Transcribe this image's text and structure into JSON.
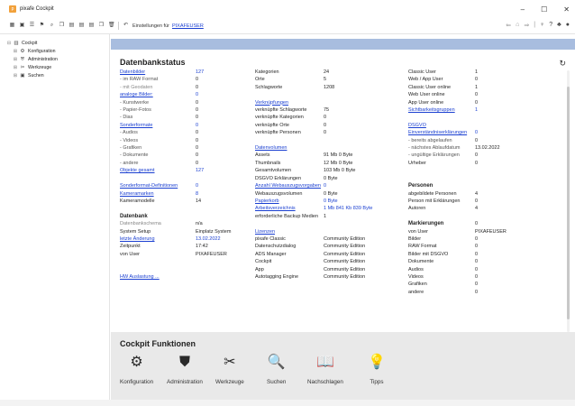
{
  "window": {
    "title": "pixafe Cockpit",
    "minimize": "–",
    "maximize": "☐",
    "close": "✕"
  },
  "toolbar": {
    "settings_label": "Einstellungen für",
    "settings_link": "PIXAFEUSER"
  },
  "tree": [
    {
      "label": "Cockpit",
      "icon": "cockpit-icon",
      "level": 0
    },
    {
      "label": "Konfiguration",
      "icon": "gear-icon",
      "level": 1
    },
    {
      "label": "Administration",
      "icon": "shield-icon",
      "level": 1
    },
    {
      "label": "Werkzeuge",
      "icon": "tools-icon",
      "level": 1
    },
    {
      "label": "Suchen",
      "icon": "search-icon",
      "level": 1
    }
  ],
  "main": {
    "title": "Datenbankstatus"
  },
  "stats": {
    "col1": [
      {
        "label": "Datenbilder",
        "value": "127",
        "style": "link"
      },
      {
        "label": "- im RAW Format",
        "value": "0",
        "style": "sub"
      },
      {
        "label": "- mit Geodaten",
        "value": "0",
        "style": "dim"
      },
      {
        "label": "analoge Bilder:",
        "value": "0",
        "style": "link"
      },
      {
        "label": "- Kunstwerke",
        "value": "0",
        "style": "sub"
      },
      {
        "label": "- Papier-Fotos",
        "value": "0",
        "style": "sub"
      },
      {
        "label": "- Dias",
        "value": "0",
        "style": "sub"
      },
      {
        "label": "Sonderformate",
        "value": "0",
        "style": "link"
      },
      {
        "label": "- Audios",
        "value": "0",
        "style": "sub"
      },
      {
        "label": "- Videos",
        "value": "0",
        "style": "sub"
      },
      {
        "label": "- Grafiken",
        "value": "0",
        "style": "sub"
      },
      {
        "label": "- Dokumente",
        "value": "0",
        "style": "sub"
      },
      {
        "label": "- andere",
        "value": "0",
        "style": "sub"
      },
      {
        "label": "Objekte gesamt",
        "value": "127",
        "style": "link"
      },
      {
        "label": "",
        "value": "",
        "style": ""
      },
      {
        "label": "Sonderformat-Definitionen",
        "value": "0",
        "style": "link"
      },
      {
        "label": "Kameramarken",
        "value": "8",
        "style": "link"
      },
      {
        "label": "Kameramodelle",
        "value": "14",
        "style": ""
      },
      {
        "label": "",
        "value": "",
        "style": ""
      },
      {
        "label": "Datenbank",
        "value": "",
        "style": "header"
      },
      {
        "label": "Datenbankschema",
        "value": "n/a",
        "style": "dim"
      },
      {
        "label": "System Setup",
        "value": "Einplatz System",
        "style": ""
      },
      {
        "label": "letzte Änderung",
        "value": "13.02.2022",
        "style": "link"
      },
      {
        "label": "Zeitpunkt",
        "value": "17:42",
        "style": ""
      },
      {
        "label": "von User",
        "value": "PIXAFEUSER",
        "style": ""
      },
      {
        "label": "",
        "value": "",
        "style": ""
      },
      {
        "label": "",
        "value": "",
        "style": ""
      },
      {
        "label": "HW Auslastung ...",
        "value": "",
        "style": "link"
      }
    ],
    "col2": [
      {
        "label": "Kategorien",
        "value": "24",
        "style": ""
      },
      {
        "label": "Orte",
        "value": "5",
        "style": ""
      },
      {
        "label": "Schlagworte",
        "value": "1208",
        "style": ""
      },
      {
        "label": "",
        "value": "",
        "style": ""
      },
      {
        "label": "Verknüpfungen",
        "value": "",
        "style": "link"
      },
      {
        "label": "verknüpfte Schlagworte",
        "value": "75",
        "style": ""
      },
      {
        "label": "verknüpfte Kategorien",
        "value": "0",
        "style": ""
      },
      {
        "label": "verknüpfte Orte",
        "value": "0",
        "style": ""
      },
      {
        "label": "verknüpfte Personen",
        "value": "0",
        "style": ""
      },
      {
        "label": "",
        "value": "",
        "style": ""
      },
      {
        "label": "Datenvolumen",
        "value": "",
        "style": "link"
      },
      {
        "label": "Assets",
        "value": "91 Mb 0 Byte",
        "style": ""
      },
      {
        "label": "Thumbnails",
        "value": "12 Mb 0 Byte",
        "style": ""
      },
      {
        "label": "Gesamtvolumen",
        "value": "103 Mb 0 Byte",
        "style": ""
      },
      {
        "label": "DSGVO Erklärungen",
        "value": "0 Byte",
        "style": ""
      },
      {
        "label": "Anzahl Webauszugsvorgaben",
        "value": "0",
        "style": "link"
      },
      {
        "label": "Webauszugsvolumen",
        "value": "0 Byte",
        "style": ""
      },
      {
        "label": "Papierkorb",
        "value": "0 Byte",
        "style": "link"
      },
      {
        "label": "Arbeitsverzeichnis",
        "value": "1 Mb 841 Kb 839 Byte",
        "style": "link"
      },
      {
        "label": "erforderliche Backup Medien",
        "value": "1",
        "style": ""
      },
      {
        "label": "",
        "value": "",
        "style": ""
      },
      {
        "label": "Lizenzen",
        "value": "",
        "style": "link"
      },
      {
        "label": "pixafe Classic",
        "value": "Community Edition",
        "style": ""
      },
      {
        "label": "Datenschutzdialog",
        "value": "Community Edition",
        "style": ""
      },
      {
        "label": "ADS Manager",
        "value": "Community Edition",
        "style": ""
      },
      {
        "label": "Cockpit",
        "value": "Community Edition",
        "style": ""
      },
      {
        "label": "App",
        "value": "Community Edition",
        "style": ""
      },
      {
        "label": "Autotagging Engine",
        "value": "Community Edition",
        "style": ""
      }
    ],
    "col3": [
      {
        "label": "Classic User",
        "value": "1",
        "style": ""
      },
      {
        "label": "Web / App User",
        "value": "0",
        "style": ""
      },
      {
        "label": "Classic User online",
        "value": "1",
        "style": ""
      },
      {
        "label": "Web User online",
        "value": "0",
        "style": ""
      },
      {
        "label": "App User online",
        "value": "0",
        "style": ""
      },
      {
        "label": "Sichtbarkeitsgruppen",
        "value": "1",
        "style": "link"
      },
      {
        "label": "",
        "value": "",
        "style": ""
      },
      {
        "label": "DSGVO",
        "value": "",
        "style": "link"
      },
      {
        "label": "Einverständniserklärungen",
        "value": "0",
        "style": "link"
      },
      {
        "label": "- bereits abgelaufen",
        "value": "0",
        "style": "sub"
      },
      {
        "label": "- nächstes Ablaufdatum",
        "value": "13.02.2022",
        "style": "sub"
      },
      {
        "label": "- ungültige Erklärungen",
        "value": "0",
        "style": "sub"
      },
      {
        "label": "Urheber",
        "value": "0",
        "style": ""
      },
      {
        "label": "",
        "value": "",
        "style": ""
      },
      {
        "label": "",
        "value": "",
        "style": ""
      },
      {
        "label": "Personen",
        "value": "",
        "style": "header"
      },
      {
        "label": "abgebildete Personen",
        "value": "4",
        "style": ""
      },
      {
        "label": "Person mit Erklärungen",
        "value": "0",
        "style": ""
      },
      {
        "label": "Autoren",
        "value": "4",
        "style": ""
      },
      {
        "label": "",
        "value": "",
        "style": ""
      },
      {
        "label": "Markierungen",
        "value": "0",
        "style": "header"
      },
      {
        "label": "von User",
        "value": "PIXAFEUSER",
        "style": ""
      },
      {
        "label": "Bilder",
        "value": "0",
        "style": ""
      },
      {
        "label": "RAW Format",
        "value": "0",
        "style": ""
      },
      {
        "label": "Bilder mit DSGVO",
        "value": "0",
        "style": ""
      },
      {
        "label": "Dokumente",
        "value": "0",
        "style": ""
      },
      {
        "label": "Audios",
        "value": "0",
        "style": ""
      },
      {
        "label": "Videos",
        "value": "0",
        "style": ""
      },
      {
        "label": "Grafiken",
        "value": "0",
        "style": ""
      },
      {
        "label": "andere",
        "value": "0",
        "style": ""
      }
    ]
  },
  "cockpit": {
    "title": "Cockpit Funktionen",
    "items": [
      {
        "label": "Konfiguration",
        "icon": "gears-icon",
        "glyph": "⚙"
      },
      {
        "label": "Administration",
        "icon": "shield-icon",
        "glyph": "⛊"
      },
      {
        "label": "Werkzeuge",
        "icon": "tools-icon",
        "glyph": "✂"
      },
      {
        "label": "Suchen",
        "icon": "search-doc-icon",
        "glyph": "🔍"
      },
      {
        "label": "Nachschlagen",
        "icon": "reader-icon",
        "glyph": "📖"
      },
      {
        "label": "Tipps",
        "icon": "lightbulb-icon",
        "glyph": "💡"
      }
    ]
  }
}
